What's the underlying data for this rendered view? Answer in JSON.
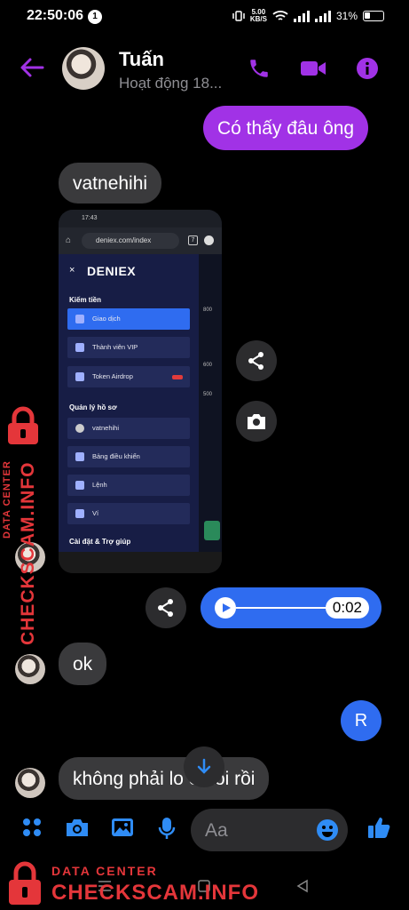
{
  "status_bar": {
    "time": "22:50:06",
    "notif_count": "1",
    "net_speed_value": "5.00",
    "net_speed_unit": "KB/S",
    "battery": "31%"
  },
  "header": {
    "contact_name": "Tuấn",
    "presence": "Hoạt động 18...",
    "accent": "#a132e6"
  },
  "messages": {
    "outgoing_1": "Có thấy đâu ông",
    "incoming_1": "vatnehihi",
    "incoming_ok": "ok",
    "incoming_last": "không phải lo   ết tôi rồi",
    "seen_initial": "R"
  },
  "screenshot_image": {
    "time": "17:43",
    "url": "deniex.com/index",
    "tab_count": "7",
    "logo": "DENIEX",
    "section_earn": "Kiếm tiền",
    "items_earn": [
      "Giao dịch",
      "Thành viên VIP",
      "Token Airdrop"
    ],
    "section_profile": "Quản lý hồ sơ",
    "items_profile": [
      "vatnehihi",
      "Bảng điều khiển",
      "Lệnh",
      "Ví"
    ],
    "section_settings": "Cài đặt & Trợ giúp",
    "side_values": [
      "800",
      "600",
      "500"
    ]
  },
  "voice": {
    "duration": "0:02"
  },
  "composer": {
    "placeholder": "Aa"
  },
  "watermark": {
    "line1": "DATA CENTER",
    "line2": "CHECKSCAM.INFO",
    "color": "#e4363a"
  },
  "icons": [
    "back-arrow-icon",
    "phone-icon",
    "video-icon",
    "info-icon",
    "share-icon",
    "camera-icon",
    "play-icon",
    "down-arrow-icon",
    "apps-icon",
    "image-icon",
    "mic-icon",
    "emoji-icon",
    "like-icon"
  ]
}
